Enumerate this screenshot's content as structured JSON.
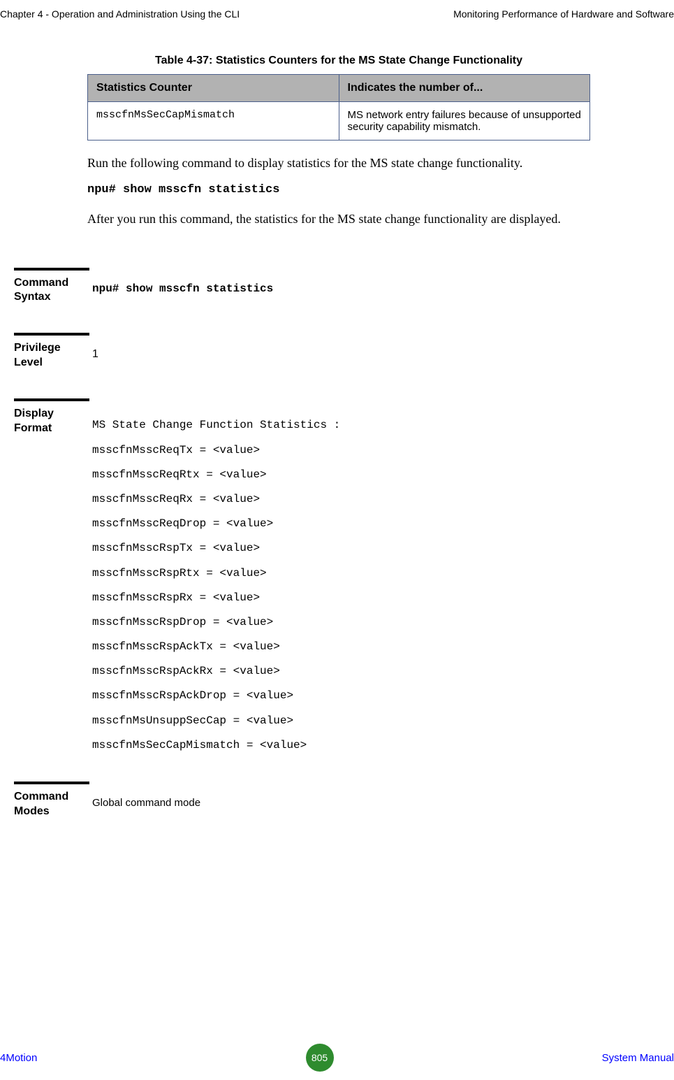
{
  "header": {
    "left": "Chapter 4 - Operation and Administration Using the CLI",
    "right": "Monitoring Performance of Hardware and Software"
  },
  "table": {
    "caption": "Table 4-37: Statistics Counters for the MS State Change Functionality",
    "headers": {
      "col1": "Statistics Counter",
      "col2": "Indicates the number of..."
    },
    "row": {
      "counter": "msscfnMsSecCapMismatch",
      "desc": "MS network entry failures because of unsupported security capability mismatch."
    }
  },
  "para1": "Run the following command to display statistics for the MS state change functionality.",
  "command1": "npu# show msscfn statistics",
  "para2": "After you run this command, the statistics for the MS state change functionality are displayed.",
  "blocks": {
    "syntax": {
      "label": "Command Syntax",
      "value": "npu# show msscfn statistics"
    },
    "privilege": {
      "label": "Privilege Level",
      "value": "1"
    },
    "display": {
      "label": "Display Format",
      "title": "MS State Change Function Statistics :",
      "lines": [
        "msscfnMsscReqTx = <value>",
        "msscfnMsscReqRtx = <value>",
        "msscfnMsscReqRx = <value>",
        "msscfnMsscReqDrop = <value>",
        "msscfnMsscRspTx = <value>",
        "msscfnMsscRspRtx = <value>",
        "msscfnMsscRspRx = <value>",
        "msscfnMsscRspDrop = <value>",
        "msscfnMsscRspAckTx = <value>",
        "msscfnMsscRspAckRx = <value>",
        "msscfnMsscRspAckDrop = <value>",
        "msscfnMsUnsuppSecCap = <value>",
        "msscfnMsSecCapMismatch = <value>"
      ]
    },
    "modes": {
      "label": "Command Modes",
      "value": "Global command mode"
    }
  },
  "footer": {
    "left": "4Motion",
    "page": "805",
    "right": "System Manual"
  }
}
